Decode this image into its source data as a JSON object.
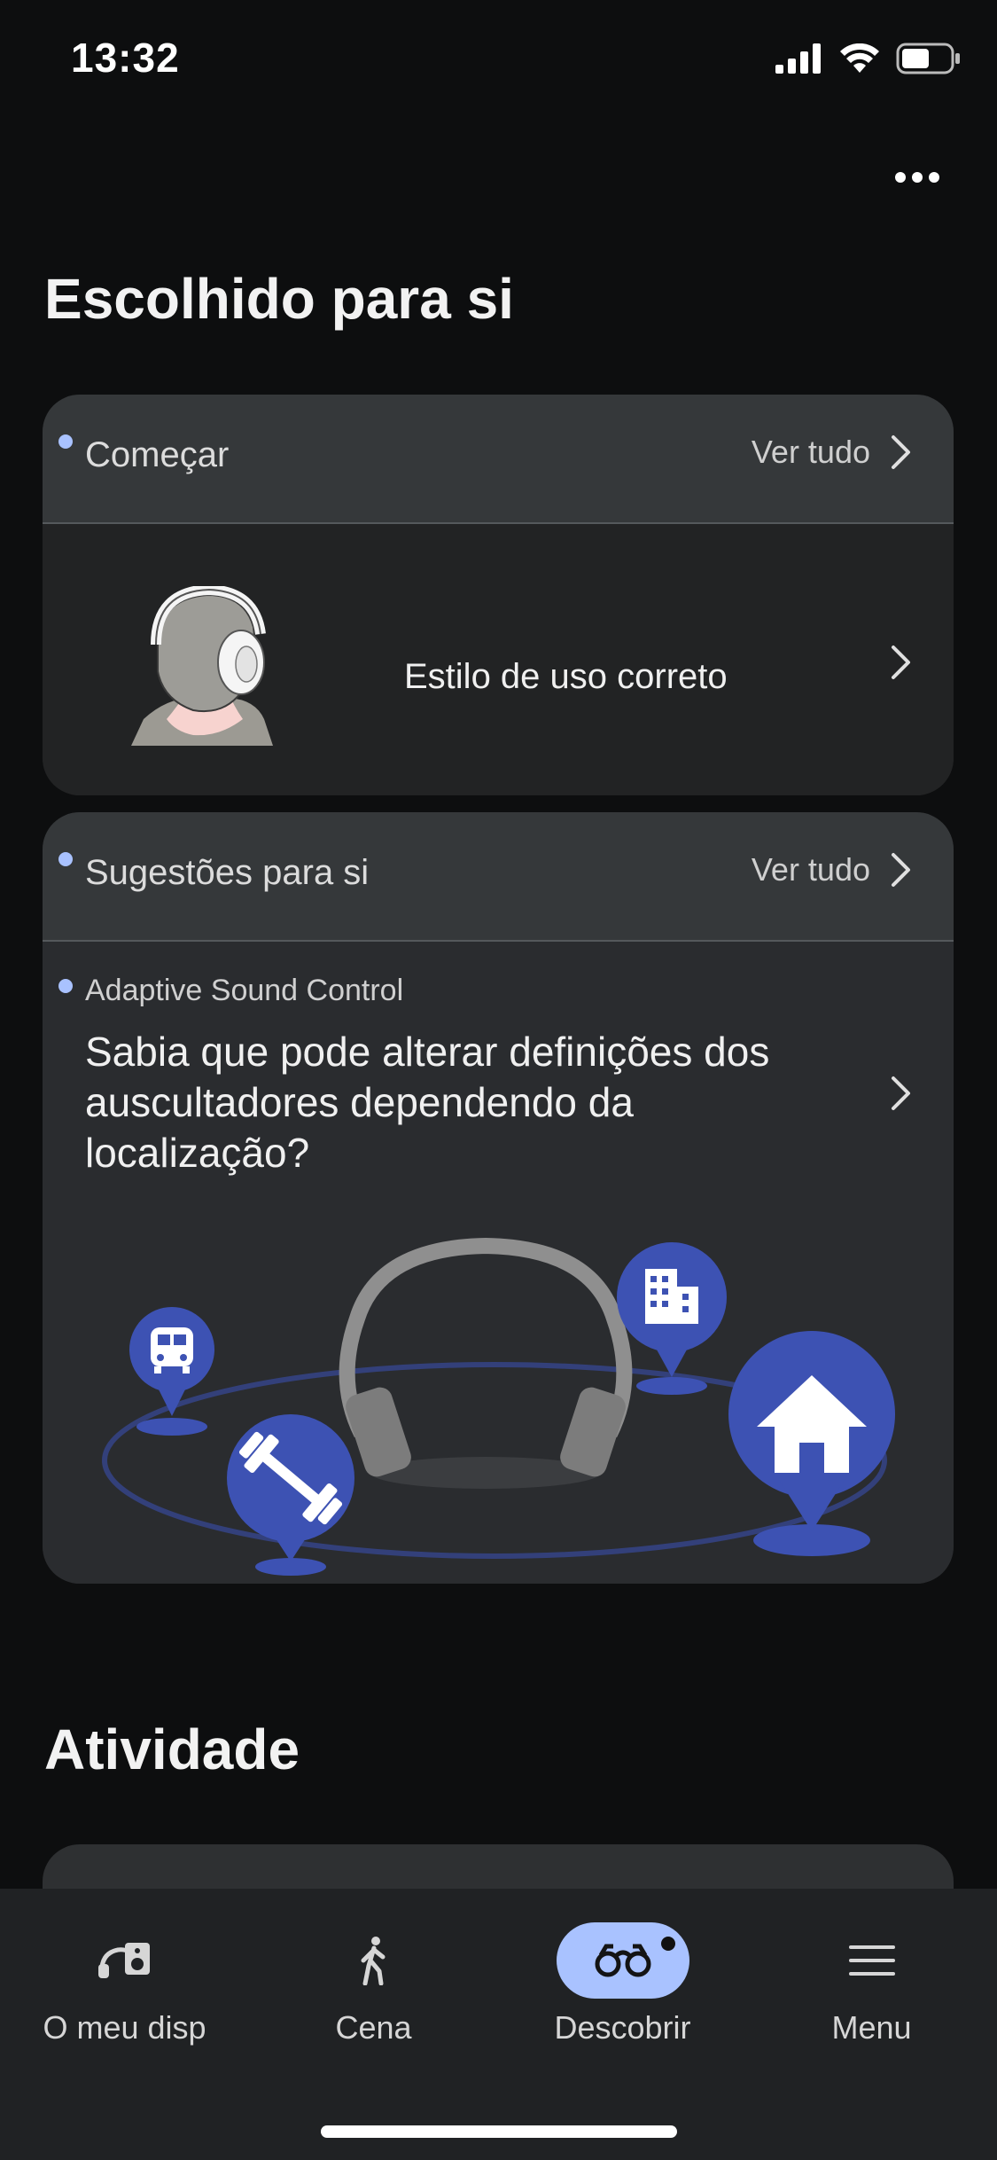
{
  "status_bar": {
    "time": "13:32"
  },
  "header": {
    "more_icon": "ellipsis-icon"
  },
  "section_picked": {
    "title": "Escolhido para si"
  },
  "card_start": {
    "title": "Começar",
    "see_all": "Ver tudo",
    "item": {
      "label": "Estilo de uso correto"
    }
  },
  "card_suggestions": {
    "title": "Sugestões para si",
    "see_all": "Ver tudo",
    "item": {
      "kicker": "Adaptive Sound Control",
      "headline": "Sabia que pode alterar definições dos auscultadores dependendo da localização?"
    }
  },
  "section_activity": {
    "title": "Atividade"
  },
  "bottom_nav": {
    "items": [
      {
        "label": "O meu disp",
        "icon": "device-icon",
        "active": false
      },
      {
        "label": "Cena",
        "icon": "walking-person-icon",
        "active": false
      },
      {
        "label": "Descobrir",
        "icon": "binoculars-icon",
        "active": true
      },
      {
        "label": "Menu",
        "icon": "hamburger-menu-icon",
        "active": false
      }
    ]
  },
  "colors": {
    "accent": "#a9c2ff",
    "map_pin_blue": "#3d52b3",
    "background": "#0d0e0f"
  }
}
